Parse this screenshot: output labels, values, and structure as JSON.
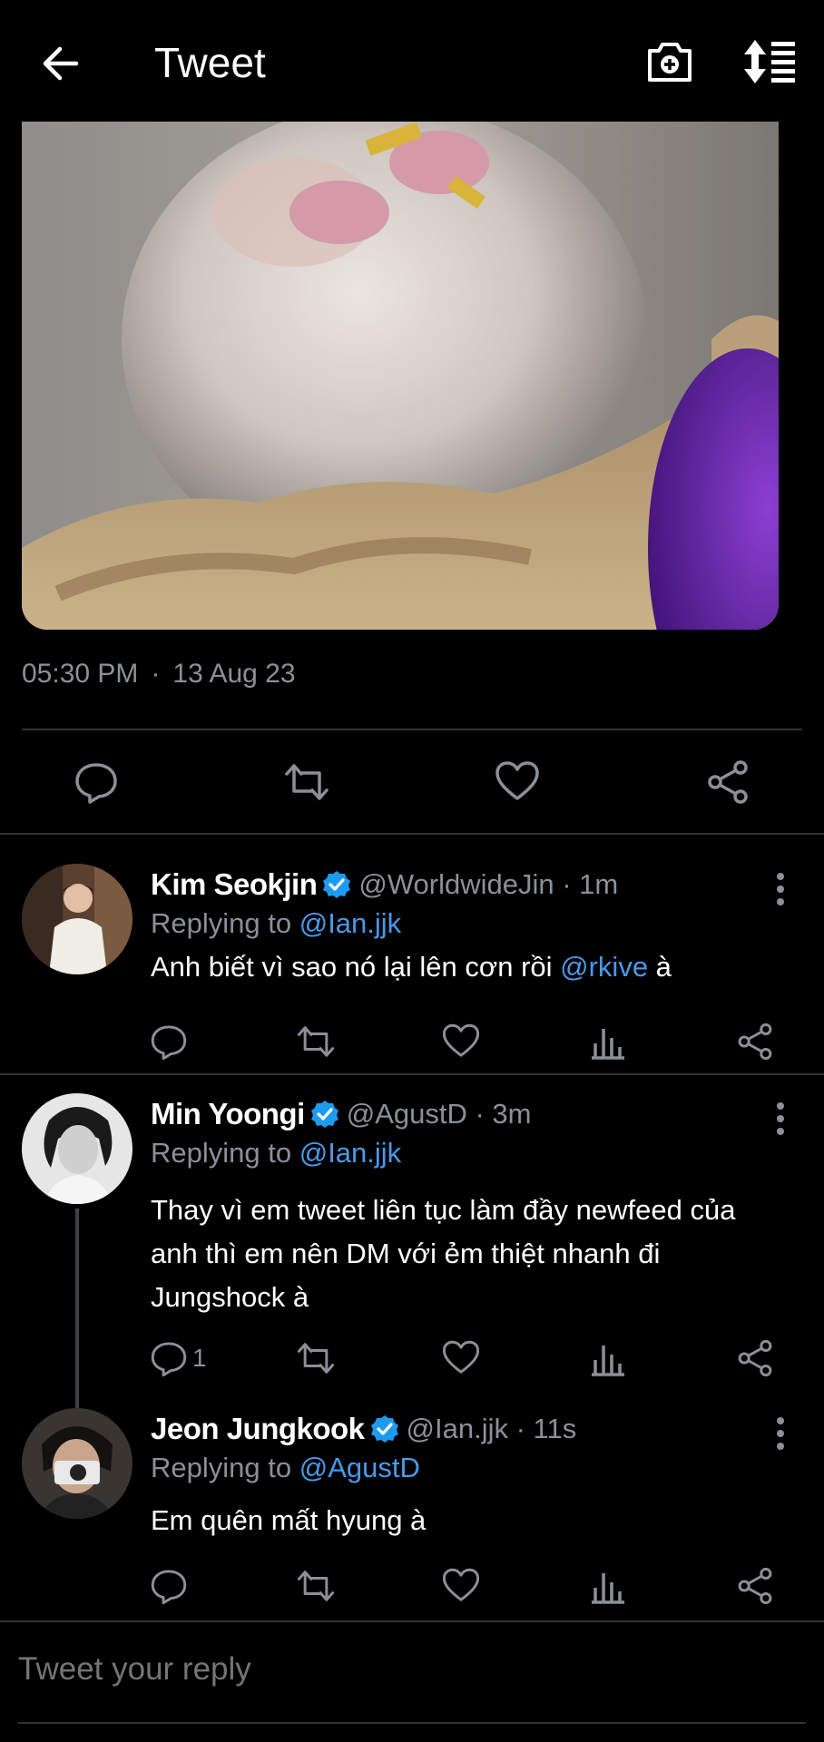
{
  "header": {
    "title": "Tweet",
    "back_icon": "arrow-left-icon",
    "camera_icon": "camera-plus-icon",
    "sort_icon": "sort-list-icon"
  },
  "media": {
    "kind": "image"
  },
  "main_tweet": {
    "time": "05:30 PM",
    "separator": "·",
    "date": "13 Aug 23"
  },
  "replies": [
    {
      "name": "Kim Seokjin",
      "handle": "@WorldwideJin · 1m",
      "replying_prefix": "Replying to ",
      "replying_to": "@Ian.jjk",
      "text_before": "Anh biết vì sao nó lại lên cơn rồi ",
      "mention": "@rkive",
      "text_after": " à"
    },
    {
      "name": "Min Yoongi",
      "handle": "@AgustD · 3m",
      "replying_prefix": "Replying to ",
      "replying_to": "@Ian.jjk",
      "text": "Thay vì em tweet liên tục làm đầy newfeed của anh thì em nên DM với ẻm thiệt nhanh đi Jungshock à",
      "reply_count": "1"
    },
    {
      "name": "Jeon Jungkook",
      "handle": "@Ian.jjk · 11s",
      "replying_prefix": "Replying to ",
      "replying_to": "@AgustD",
      "text": "Em quên mất hyung à"
    }
  ],
  "reply_box": {
    "placeholder": "Tweet your reply"
  },
  "colors": {
    "background": "#000000",
    "link": "#4a99e9",
    "verified": "#1d9bf0",
    "muted": "#8b9098"
  }
}
